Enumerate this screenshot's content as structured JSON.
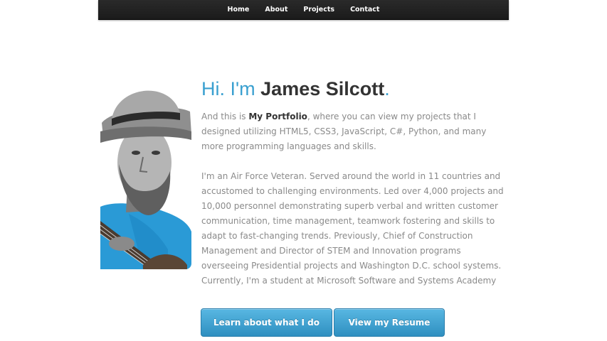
{
  "nav": {
    "items": [
      {
        "label": "Home"
      },
      {
        "label": "About"
      },
      {
        "label": "Projects"
      },
      {
        "label": "Contact"
      }
    ]
  },
  "hero": {
    "greeting": "Hi. I'm ",
    "name": "James Silcott",
    "period": ".",
    "intro_prefix": "And this is ",
    "intro_bold": "My Portfolio",
    "intro_suffix": ", where you can view my projects that I designed utilizing HTML5, CSS3, JavaScript, C#, Python, and many more programming languages and skills.",
    "bio": "I'm an Air Force Veteran. Served around the world in 11 countries and accustomed to challenging environments. Led over 4,000 projects and 10,000 personnel demonstrating superb verbal and written customer communication, time management, teamwork fostering and skills to adapt to fast-changing trends. Previously, Chief of Construction Management and Director of STEM and Innovation programs overseeing Presidential projects and Washington D.C. school systems. Currently, I'm a student at Microsoft Software and Systems Academy"
  },
  "buttons": {
    "learn": "Learn about what I do",
    "resume": "View my Resume"
  },
  "colors": {
    "accent": "#3aa0d0",
    "nav_bg": "#1f1f1f",
    "text_muted": "#8a8a8a",
    "text_dark": "#333333",
    "button": "#3d9fd0"
  }
}
